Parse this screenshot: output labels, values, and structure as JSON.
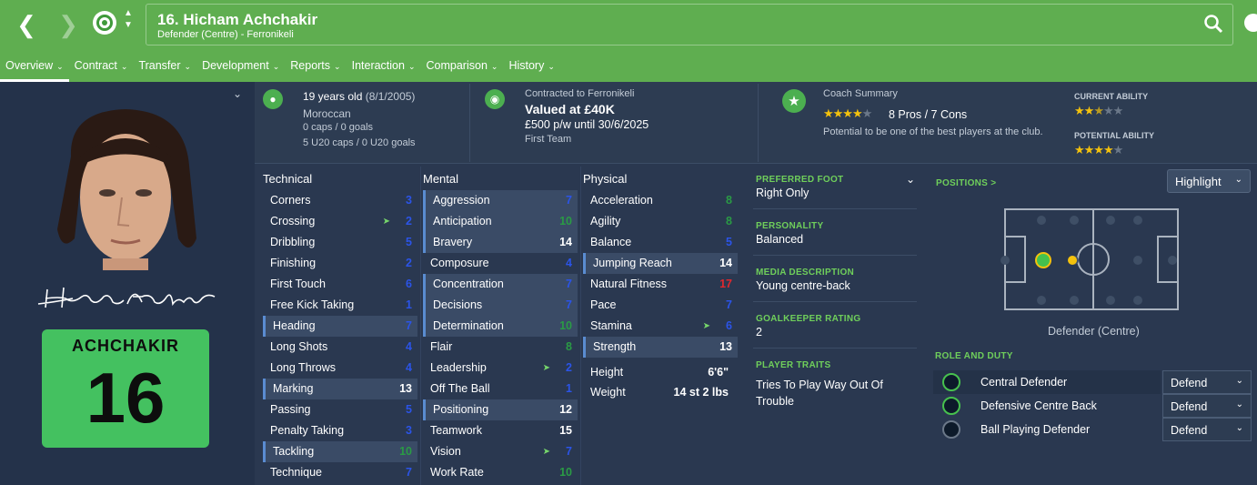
{
  "header": {
    "player_name": "16. Hicham Achchakir",
    "player_sub": "Defender (Centre) - Ferronikeli"
  },
  "tabs": [
    {
      "label": "Overview"
    },
    {
      "label": "Contract"
    },
    {
      "label": "Transfer"
    },
    {
      "label": "Development"
    },
    {
      "label": "Reports"
    },
    {
      "label": "Interaction"
    },
    {
      "label": "Comparison"
    },
    {
      "label": "History"
    }
  ],
  "profile": {
    "shirt_name": "ACHCHAKIR",
    "shirt_number": "16",
    "shirt_color": "#44c160"
  },
  "info": {
    "age": "19 years old",
    "dob": "(8/1/2005)",
    "nationality": "Moroccan",
    "caps": "0 caps / 0 goals",
    "u20_caps": "5 U20 caps / 0 U20 goals",
    "contract_with": "Contracted to Ferronikeli",
    "value": "Valued at £40K",
    "wage": "£500 p/w until 30/6/2025",
    "squad": "First Team",
    "coach_label": "Coach Summary",
    "pros_cons": "8 Pros / 7 Cons",
    "potential_text": "Potential to be one of the best players at the club.",
    "current_ability_label": "CURRENT ABILITY",
    "potential_ability_label": "POTENTIAL ABILITY",
    "coach_stars": 4,
    "current_ability_stars": 2.5,
    "potential_ability_stars": 4
  },
  "technical": {
    "header": "Technical",
    "items": [
      {
        "label": "Corners",
        "value": "3",
        "color": "blue"
      },
      {
        "label": "Crossing",
        "value": "2",
        "color": "blue",
        "arrow": true
      },
      {
        "label": "Dribbling",
        "value": "5",
        "color": "blue"
      },
      {
        "label": "Finishing",
        "value": "2",
        "color": "blue"
      },
      {
        "label": "First Touch",
        "value": "6",
        "color": "blue"
      },
      {
        "label": "Free Kick Taking",
        "value": "1",
        "color": "blue"
      },
      {
        "label": "Heading",
        "value": "7",
        "color": "blue",
        "hl": true
      },
      {
        "label": "Long Shots",
        "value": "4",
        "color": "blue"
      },
      {
        "label": "Long Throws",
        "value": "4",
        "color": "blue"
      },
      {
        "label": "Marking",
        "value": "13",
        "color": "white",
        "hl": true
      },
      {
        "label": "Passing",
        "value": "5",
        "color": "blue"
      },
      {
        "label": "Penalty Taking",
        "value": "3",
        "color": "blue"
      },
      {
        "label": "Tackling",
        "value": "10",
        "color": "green",
        "hl": true
      },
      {
        "label": "Technique",
        "value": "7",
        "color": "blue"
      }
    ]
  },
  "mental": {
    "header": "Mental",
    "items": [
      {
        "label": "Aggression",
        "value": "7",
        "color": "blue",
        "hl": true
      },
      {
        "label": "Anticipation",
        "value": "10",
        "color": "green",
        "hl": true
      },
      {
        "label": "Bravery",
        "value": "14",
        "color": "white",
        "hl": true
      },
      {
        "label": "Composure",
        "value": "4",
        "color": "blue"
      },
      {
        "label": "Concentration",
        "value": "7",
        "color": "blue",
        "hl": true
      },
      {
        "label": "Decisions",
        "value": "7",
        "color": "blue",
        "hl": true
      },
      {
        "label": "Determination",
        "value": "10",
        "color": "green",
        "hl": true
      },
      {
        "label": "Flair",
        "value": "8",
        "color": "green"
      },
      {
        "label": "Leadership",
        "value": "2",
        "color": "blue",
        "arrow": true
      },
      {
        "label": "Off The Ball",
        "value": "1",
        "color": "blue"
      },
      {
        "label": "Positioning",
        "value": "12",
        "color": "white",
        "hl": true
      },
      {
        "label": "Teamwork",
        "value": "15",
        "color": "white"
      },
      {
        "label": "Vision",
        "value": "7",
        "color": "blue",
        "arrow": true
      },
      {
        "label": "Work Rate",
        "value": "10",
        "color": "green"
      }
    ]
  },
  "physical": {
    "header": "Physical",
    "items": [
      {
        "label": "Acceleration",
        "value": "8",
        "color": "green"
      },
      {
        "label": "Agility",
        "value": "8",
        "color": "green"
      },
      {
        "label": "Balance",
        "value": "5",
        "color": "blue"
      },
      {
        "label": "Jumping Reach",
        "value": "14",
        "color": "white",
        "hl": true
      },
      {
        "label": "Natural Fitness",
        "value": "17",
        "color": "red"
      },
      {
        "label": "Pace",
        "value": "7",
        "color": "blue"
      },
      {
        "label": "Stamina",
        "value": "6",
        "color": "blue",
        "arrow": true
      },
      {
        "label": "Strength",
        "value": "13",
        "color": "white",
        "hl": true
      }
    ],
    "height_label": "Height",
    "height_value": "6'6\"",
    "weight_label": "Weight",
    "weight_value": "14 st 2 lbs"
  },
  "details": {
    "foot_label": "PREFERRED FOOT",
    "foot_value": "Right Only",
    "personality_label": "PERSONALITY",
    "personality_value": "Balanced",
    "media_label": "MEDIA DESCRIPTION",
    "media_value": "Young centre-back",
    "gk_label": "GOALKEEPER RATING",
    "gk_value": "2",
    "traits_label": "PLAYER TRAITS",
    "traits_value": "Tries To Play Way Out Of Trouble"
  },
  "positions": {
    "label": "POSITIONS >",
    "highlight": "Highlight",
    "position_name": "Defender (Centre)",
    "role_label": "ROLE AND DUTY",
    "roles": [
      {
        "name": "Central Defender",
        "duty": "Defend"
      },
      {
        "name": "Defensive Centre Back",
        "duty": "Defend"
      },
      {
        "name": "Ball Playing Defender",
        "duty": "Defend"
      }
    ]
  }
}
